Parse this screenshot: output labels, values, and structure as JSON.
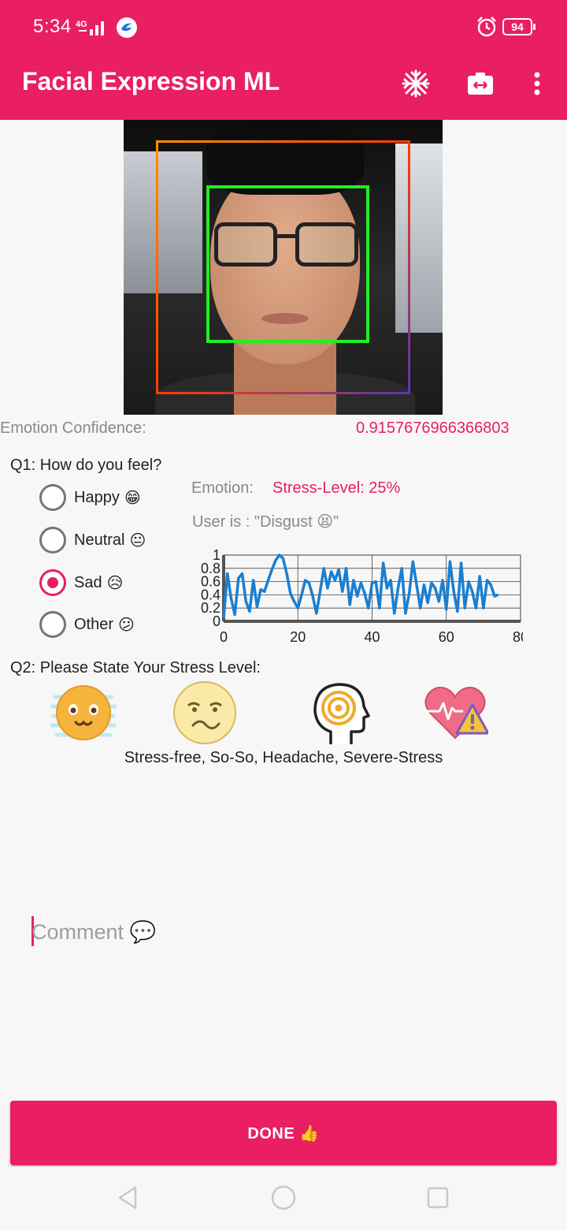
{
  "status_bar": {
    "time": "5:34",
    "network": "4G",
    "battery": "94"
  },
  "app_bar": {
    "title": "Facial Expression ML",
    "icons": [
      "snowflake-icon",
      "switch-camera-icon",
      "more-vert-icon"
    ]
  },
  "camera": {
    "faces_detected": 1
  },
  "confidence": {
    "label": "Emotion Confidence:",
    "value": "0.9157676966366803"
  },
  "q1": {
    "question": "Q1: How do you feel?",
    "options": [
      {
        "label": "Happy",
        "emoji": "😁",
        "checked": false
      },
      {
        "label": "Neutral",
        "emoji": "😐",
        "checked": false
      },
      {
        "label": "Sad",
        "emoji": "😥",
        "checked": true
      },
      {
        "label": "Other",
        "emoji": "😕",
        "checked": false
      }
    ]
  },
  "emotion": {
    "label": "Emotion:",
    "stress_level": "Stress-Level: 25%",
    "user_is": "User is :  \"Disgust 😫\""
  },
  "chart_data": {
    "type": "line",
    "title": "",
    "xlabel": "",
    "ylabel": "",
    "xlim": [
      0,
      80
    ],
    "ylim": [
      0,
      1
    ],
    "x_ticks": [
      "0",
      "20",
      "40",
      "60",
      "80"
    ],
    "y_ticks": [
      "0",
      "0.2",
      "0.4",
      "0.6",
      "0.8",
      "1"
    ],
    "grid": true,
    "color": "#1a7fd1",
    "series": [
      {
        "values": [
          0.05,
          0.72,
          0.35,
          0.1,
          0.65,
          0.72,
          0.3,
          0.15,
          0.62,
          0.22,
          0.48,
          0.45,
          0.62,
          0.78,
          0.92,
          1.0,
          0.95,
          0.72,
          0.42,
          0.3,
          0.2,
          0.4,
          0.62,
          0.58,
          0.38,
          0.12,
          0.45,
          0.8,
          0.5,
          0.75,
          0.62,
          0.78,
          0.45,
          0.8,
          0.25,
          0.62,
          0.38,
          0.58,
          0.42,
          0.2,
          0.58,
          0.6,
          0.2,
          0.88,
          0.5,
          0.62,
          0.12,
          0.5,
          0.8,
          0.12,
          0.42,
          0.9,
          0.55,
          0.2,
          0.55,
          0.28,
          0.58,
          0.5,
          0.3,
          0.62,
          0.18,
          0.9,
          0.45,
          0.15,
          0.88,
          0.2,
          0.6,
          0.45,
          0.2,
          0.68,
          0.2,
          0.62,
          0.55,
          0.38,
          0.4
        ]
      }
    ]
  },
  "q2": {
    "question": "Q2: Please State Your Stress Level:",
    "icons": [
      "stress-free-icon",
      "so-so-icon",
      "headache-icon",
      "severe-stress-icon"
    ],
    "caption": "Stress-free, So-So, Headache, Severe-Stress"
  },
  "comment": {
    "placeholder": "Comment 💬"
  },
  "done_button": {
    "label": "DONE 👍"
  },
  "colors": {
    "primary": "#e91e63",
    "chart_line": "#1a7fd1",
    "face_box": "#22ee22"
  }
}
